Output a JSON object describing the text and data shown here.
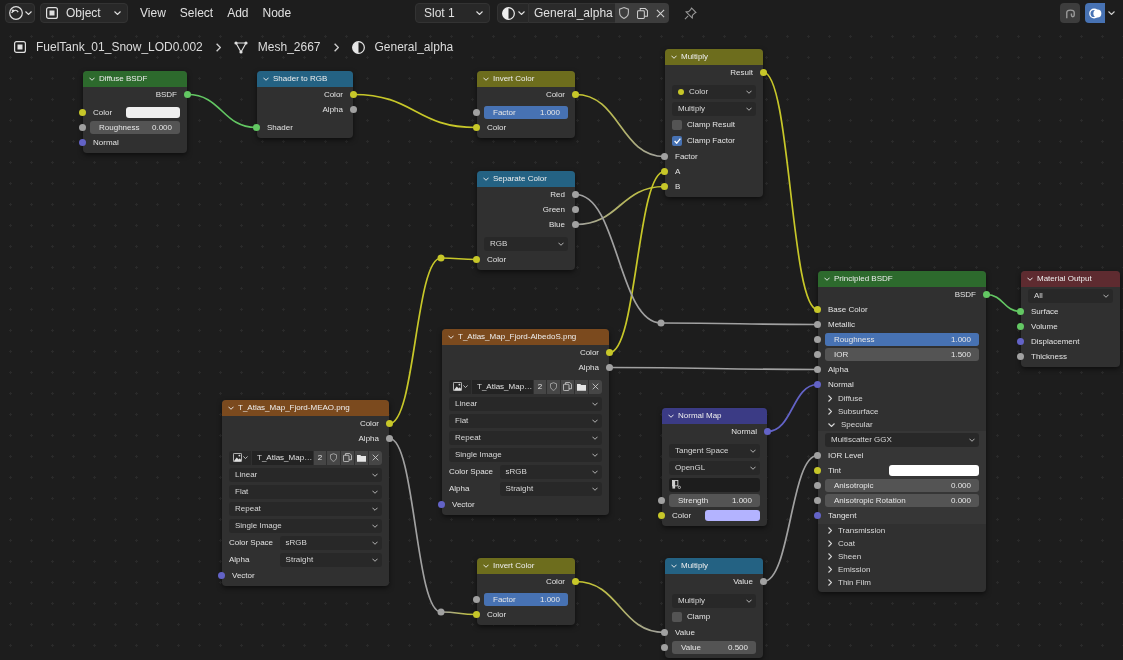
{
  "toolbar": {
    "mode": "Object",
    "menus": [
      "View",
      "Select",
      "Add",
      "Node"
    ],
    "slot": "Slot 1",
    "material": "General_alpha"
  },
  "breadcrumb": [
    {
      "kind": "object",
      "label": "FuelTank_01_Snow_LOD0.002"
    },
    {
      "kind": "mesh",
      "label": "Mesh_2667"
    },
    {
      "kind": "material",
      "label": "General_alpha"
    }
  ],
  "nodes": [
    {
      "title": "Diffuse BSDF",
      "color": "#2d6a2d",
      "rows": [
        {
          "kind": "output",
          "label": "BSDF",
          "color": "#63c763"
        },
        {
          "kind": "swatch",
          "label": "Color",
          "color": "#c7c729",
          "swatch": {
            "color": "#f0f0f0"
          }
        },
        {
          "kind": "field",
          "label": "Roughness",
          "value": "0.000",
          "color": "#a1a1a1"
        },
        {
          "kind": "input",
          "label": "Normal",
          "color": "#6363c7"
        }
      ]
    },
    {
      "title": "Shader to RGB",
      "color": "#246283",
      "rows": [
        {
          "kind": "output",
          "label": "Color",
          "color": "#c7c729"
        },
        {
          "kind": "output",
          "label": "Alpha",
          "color": "#a1a1a1"
        },
        {
          "kind": "input",
          "label": "Shader",
          "color": "#63c763"
        }
      ]
    },
    {
      "title": "Invert Color",
      "color": "#6d6d1d",
      "rows": [
        {
          "kind": "output",
          "label": "Color",
          "color": "#c7c729"
        },
        {
          "kind": "field",
          "label": "Factor",
          "value": "1.000",
          "color": "#a1a1a1",
          "level": 1
        },
        {
          "kind": "input",
          "label": "Color",
          "color": "#c7c729"
        }
      ]
    },
    {
      "title": "Multiply",
      "color": "#6d6d1d",
      "rows": [
        {
          "kind": "output",
          "label": "Result",
          "color": "#c7c729"
        },
        {
          "kind": "dropdown",
          "value": "Color",
          "color": "#c7c729"
        },
        {
          "kind": "dropdown",
          "value": "Multiply"
        },
        {
          "kind": "checkbox",
          "label": "Clamp Result",
          "checked": false
        },
        {
          "kind": "checkbox",
          "label": "Clamp Factor",
          "checked": true
        },
        {
          "kind": "input",
          "label": "Factor",
          "color": "#a1a1a1"
        },
        {
          "kind": "input",
          "label": "A",
          "color": "#c7c729"
        },
        {
          "kind": "input",
          "label": "B",
          "color": "#c7c729"
        }
      ]
    },
    {
      "title": "Separate Color",
      "color": "#246283",
      "rows": [
        {
          "kind": "output",
          "label": "Red",
          "color": "#a1a1a1"
        },
        {
          "kind": "output",
          "label": "Green",
          "color": "#a1a1a1"
        },
        {
          "kind": "output",
          "label": "Blue",
          "color": "#a1a1a1"
        },
        {
          "kind": "dropdown",
          "value": "RGB"
        },
        {
          "kind": "input",
          "label": "Color",
          "color": "#c7c729"
        }
      ]
    },
    {
      "title": "T_Atlas_Map_Fjord-AlbedoS.png",
      "color": "#7b4a1e",
      "rows": [
        {
          "kind": "output",
          "label": "Color",
          "color": "#c7c729"
        },
        {
          "kind": "output",
          "label": "Alpha",
          "color": "#a1a1a1"
        },
        {
          "kind": "image",
          "name": "T_Atlas_Map…",
          "users": "2"
        },
        {
          "kind": "dropdown",
          "value": "Linear"
        },
        {
          "kind": "dropdown",
          "value": "Flat"
        },
        {
          "kind": "dropdown",
          "value": "Repeat"
        },
        {
          "kind": "dropdown",
          "value": "Single Image"
        },
        {
          "kind": "property",
          "label": "Color Space",
          "value": "sRGB"
        },
        {
          "kind": "property",
          "label": "Alpha",
          "value": "Straight"
        },
        {
          "kind": "input",
          "label": "Vector",
          "color": "#6363c7"
        }
      ]
    },
    {
      "title": "T_Atlas_Map_Fjord-MEAO.png",
      "color": "#7b4a1e",
      "rows": [
        {
          "kind": "output",
          "label": "Color",
          "color": "#c7c729"
        },
        {
          "kind": "output",
          "label": "Alpha",
          "color": "#a1a1a1"
        },
        {
          "kind": "image",
          "name": "T_Atlas_Map…",
          "users": "2"
        },
        {
          "kind": "dropdown",
          "value": "Linear"
        },
        {
          "kind": "dropdown",
          "value": "Flat"
        },
        {
          "kind": "dropdown",
          "value": "Repeat"
        },
        {
          "kind": "dropdown",
          "value": "Single Image"
        },
        {
          "kind": "property",
          "label": "Color Space",
          "value": "sRGB"
        },
        {
          "kind": "property",
          "label": "Alpha",
          "value": "Straight"
        },
        {
          "kind": "input",
          "label": "Vector",
          "color": "#6363c7"
        }
      ]
    },
    {
      "title": "Normal Map",
      "color": "#3b3b85",
      "rows": [
        {
          "kind": "output",
          "label": "Normal",
          "color": "#6363c7"
        },
        {
          "kind": "dropdown",
          "value": "Tangent Space"
        },
        {
          "kind": "dropdown",
          "value": "OpenGL"
        },
        {
          "kind": "uv_field"
        },
        {
          "kind": "field",
          "label": "Strength",
          "value": "1.000",
          "color": "#a1a1a1"
        },
        {
          "kind": "swatch",
          "label": "Color",
          "color": "#c7c729",
          "swatch": {
            "color": "#b3b3ff"
          }
        }
      ]
    },
    {
      "title": "Principled BSDF",
      "color": "#2d6a2d",
      "rows": [
        {
          "kind": "output",
          "label": "BSDF",
          "color": "#63c763"
        },
        {
          "kind": "input",
          "label": "Base Color",
          "color": "#c7c729"
        },
        {
          "kind": "input",
          "label": "Metallic",
          "color": "#a1a1a1"
        },
        {
          "kind": "field",
          "label": "Roughness",
          "value": "1.000",
          "color": "#a1a1a1",
          "level": 1
        },
        {
          "kind": "field",
          "label": "IOR",
          "value": "1.500",
          "color": "#a1a1a1"
        },
        {
          "kind": "input",
          "label": "Alpha",
          "color": "#a1a1a1"
        },
        {
          "kind": "input",
          "label": "Normal",
          "color": "#6363c7"
        },
        {
          "kind": "panel",
          "label": "Diffuse",
          "expanded": false
        },
        {
          "kind": "panel",
          "label": "Subsurface",
          "expanded": false
        },
        {
          "kind": "panel",
          "label": "Specular",
          "expanded": true,
          "children": [
            {
              "kind": "dropdown",
              "value": "Multiscatter GGX"
            },
            {
              "kind": "input",
              "label": "IOR Level",
              "color": "#a1a1a1"
            },
            {
              "kind": "swatch",
              "label": "Tint",
              "color": "#c7c729",
              "swatch": {
                "color": "#ffffff"
              }
            },
            {
              "kind": "field",
              "label": "Anisotropic",
              "value": "0.000",
              "color": "#a1a1a1"
            },
            {
              "kind": "field",
              "label": "Anisotropic Rotation",
              "value": "0.000",
              "color": "#a1a1a1"
            },
            {
              "kind": "input",
              "label": "Tangent",
              "color": "#6363c7"
            }
          ]
        },
        {
          "kind": "panel",
          "label": "Transmission",
          "expanded": false
        },
        {
          "kind": "panel",
          "label": "Coat",
          "expanded": false
        },
        {
          "kind": "panel",
          "label": "Sheen",
          "expanded": false
        },
        {
          "kind": "panel",
          "label": "Emission",
          "expanded": false
        },
        {
          "kind": "panel",
          "label": "Thin Film",
          "expanded": false
        }
      ]
    },
    {
      "title": "Material Output",
      "color": "#5e2b30",
      "rows": [
        {
          "kind": "dropdown",
          "value": "All"
        },
        {
          "kind": "input",
          "label": "Surface",
          "color": "#63c763"
        },
        {
          "kind": "input",
          "label": "Volume",
          "color": "#63c763"
        },
        {
          "kind": "input",
          "label": "Displacement",
          "color": "#6363c7"
        },
        {
          "kind": "input",
          "label": "Thickness",
          "color": "#a1a1a1"
        }
      ]
    },
    {
      "title": "Invert Color",
      "color": "#6d6d1d",
      "rows": [
        {
          "kind": "output",
          "label": "Color",
          "color": "#c7c729"
        },
        {
          "kind": "field",
          "label": "Factor",
          "value": "1.000",
          "color": "#a1a1a1",
          "level": 1
        },
        {
          "kind": "input",
          "label": "Color",
          "color": "#c7c729"
        }
      ]
    },
    {
      "title": "Multiply",
      "color": "#246283",
      "rows": [
        {
          "kind": "output",
          "label": "Value",
          "color": "#a1a1a1"
        },
        {
          "kind": "dropdown",
          "value": "Multiply"
        },
        {
          "kind": "checkbox",
          "label": "Clamp",
          "checked": false
        },
        {
          "kind": "input",
          "label": "Value",
          "color": "#a1a1a1"
        },
        {
          "kind": "field",
          "label": "Value",
          "value": "0.500",
          "color": "#a1a1a1"
        }
      ]
    }
  ]
}
